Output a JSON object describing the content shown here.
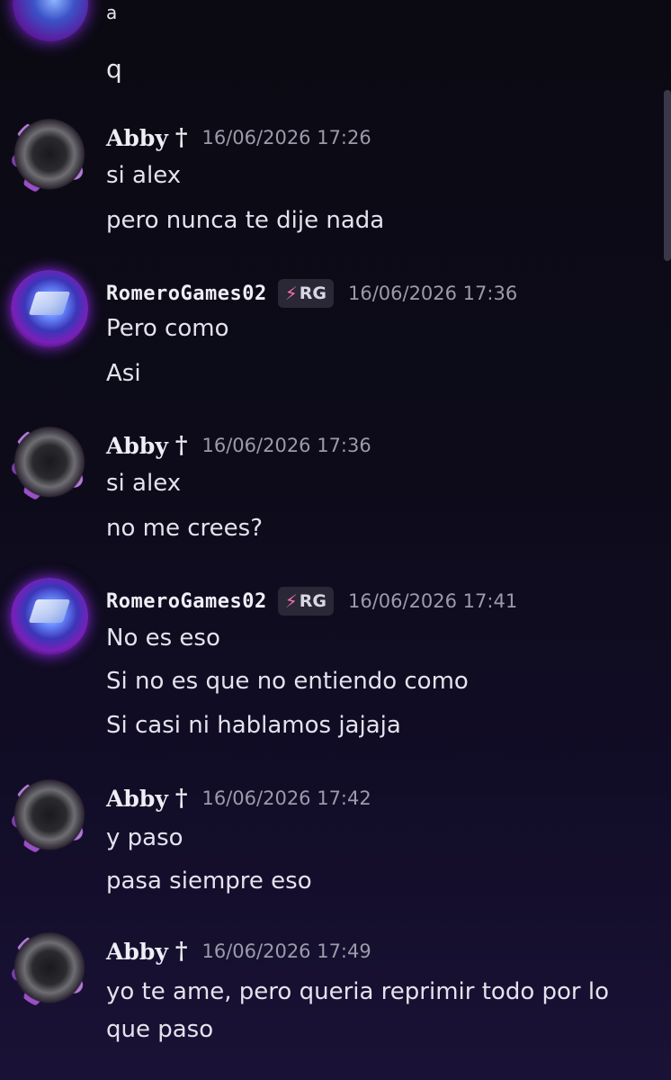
{
  "top": {
    "line1": "a",
    "line2": "q"
  },
  "messages": [
    {
      "user": "Abby",
      "badge": "†",
      "time": "16/06/2026 17:26",
      "lines": [
        "si alex",
        "pero nunca te dije nada"
      ]
    },
    {
      "user": "RomeroGames02",
      "tag": "RG",
      "time": "16/06/2026 17:36",
      "lines": [
        "Pero como",
        "Asi"
      ]
    },
    {
      "user": "Abby",
      "badge": "†",
      "time": "16/06/2026 17:36",
      "lines": [
        "si alex",
        "no me crees?"
      ]
    },
    {
      "user": "RomeroGames02",
      "tag": "RG",
      "time": "16/06/2026 17:41",
      "lines": [
        "No es eso",
        "Si no es que no entiendo como",
        "Si casi ni hablamos jajaja"
      ]
    },
    {
      "user": "Abby",
      "badge": "†",
      "time": "16/06/2026 17:42",
      "lines": [
        "y paso",
        "pasa siempre eso"
      ]
    },
    {
      "user": "Abby",
      "badge": "†",
      "time": "16/06/2026 17:49",
      "lines": [
        "yo te ame, pero queria reprimir todo por lo",
        "que paso"
      ]
    }
  ],
  "colors": {
    "background": "#0b0a12",
    "tag_bolt": "#f36fb0",
    "timestamp": "#9d9aab"
  }
}
